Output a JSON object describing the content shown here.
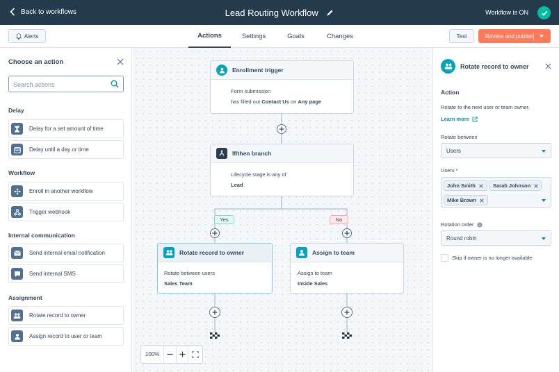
{
  "topbar": {
    "back_label": "Back to workflows",
    "workflow_title": "Lead Routing Workflow",
    "status_label": "Workflow is ON"
  },
  "toolbar": {
    "alerts_label": "Alerts",
    "tabs": [
      {
        "label": "Actions",
        "active": true
      },
      {
        "label": "Settings",
        "active": false
      },
      {
        "label": "Goals",
        "active": false
      },
      {
        "label": "Changes",
        "active": false
      }
    ],
    "test_label": "Test",
    "publish_label": "Review and publish"
  },
  "left_panel": {
    "title": "Choose an action",
    "search_placeholder": "Search actions",
    "groups": [
      {
        "title": "Delay",
        "items": [
          {
            "label": "Delay for a set amount of time",
            "icon": "hourglass-icon"
          },
          {
            "label": "Delay until a day or time",
            "icon": "calendar-icon"
          }
        ]
      },
      {
        "title": "Workflow",
        "items": [
          {
            "label": "Enroll in another workflow",
            "icon": "workflow-icon"
          },
          {
            "label": "Trigger webhook",
            "icon": "webhook-icon"
          }
        ]
      },
      {
        "title": "Internal communication",
        "items": [
          {
            "label": "Send internal email notification",
            "icon": "email-icon"
          },
          {
            "label": "Send internal SMS",
            "icon": "sms-icon"
          }
        ]
      },
      {
        "title": "Assignment",
        "items": [
          {
            "label": "Rotate record to owner",
            "icon": "rotate-owner-icon"
          },
          {
            "label": "Assign record to user or team",
            "icon": "assign-user-icon"
          }
        ]
      }
    ]
  },
  "canvas": {
    "trigger": {
      "title": "Enrollment trigger",
      "line1": "Form submission",
      "line2_pre": "has filled out",
      "line2_form": "Contact Us",
      "line2_mid": "on",
      "line2_page": "Any page"
    },
    "branch": {
      "title": "If/then branch",
      "line1": "Lifecycle stage is any of",
      "line2": "Lead"
    },
    "yes_label": "Yes",
    "no_label": "No",
    "rotate_node": {
      "title": "Rotate record to owner",
      "line1": "Rotate between users",
      "line2": "Sales Team"
    },
    "assign_node": {
      "title": "Assign to team",
      "line1": "Assign to team",
      "line2": "Inside Sales"
    },
    "zoom_level": "100%"
  },
  "right_panel": {
    "title": "Rotate record to owner",
    "section": "Action",
    "description": "Rotate to the next user or team owner.",
    "learn_more": "Learn more",
    "rotate_between_label": "Rotate between",
    "rotate_between_value": "Users",
    "users_label": "Users *",
    "users": [
      "John Smith",
      "Sarah Johnson",
      "Mike Brown"
    ],
    "rotation_order_label": "Rotation order",
    "rotation_order_value": "Round robin",
    "skip_label": "Skip if owner is no longer available",
    "skip_checked": false
  },
  "colors": {
    "topbar": "#243b4e",
    "accent_orange": "#ff7a59",
    "status_green": "#00bda5",
    "teal": "#00a4bd",
    "link": "#0091ae",
    "branch_icon": "#2d3e50"
  }
}
